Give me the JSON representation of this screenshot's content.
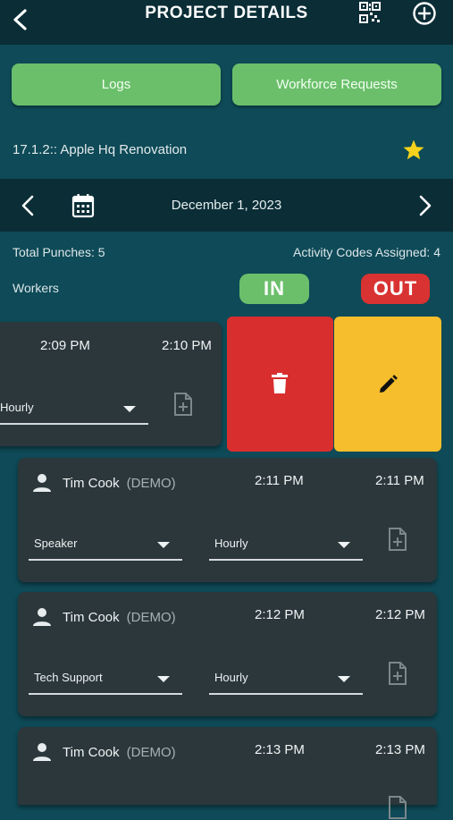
{
  "header": {
    "title": "PROJECT DETAILS"
  },
  "buttons": {
    "logs": "Logs",
    "workforce": "Workforce Requests"
  },
  "project": {
    "name": "17.1.2:: Apple Hq Renovation"
  },
  "datebar": {
    "date": "December 1, 2023"
  },
  "summary": {
    "total_punches": "Total Punches: 5",
    "activity_codes": "Activity Codes Assigned: 4",
    "workers_label": "Workers",
    "in_label": "IN",
    "out_label": "OUT"
  },
  "swiped_card": {
    "in_time": "2:09 PM",
    "out_time": "2:10 PM",
    "pay_type": "Hourly"
  },
  "cards": [
    {
      "first": "Tim",
      "last": "Cook",
      "tag": "(DEMO)",
      "in_time": "2:11 PM",
      "out_time": "2:11 PM",
      "activity": "Speaker",
      "pay_type": "Hourly"
    },
    {
      "first": "Tim",
      "last": "Cook",
      "tag": "(DEMO)",
      "in_time": "2:12 PM",
      "out_time": "2:12 PM",
      "activity": "Tech Support",
      "pay_type": "Hourly"
    },
    {
      "first": "Tim",
      "last": "Cook",
      "tag": "(DEMO)",
      "in_time": "2:13 PM",
      "out_time": "2:13 PM",
      "activity": "",
      "pay_type": ""
    }
  ],
  "colors": {
    "background": "#0e4a57",
    "header": "#0a2d36",
    "green": "#6bbf6b",
    "in_pill": "#6bbf6b",
    "out_pill": "#d93232",
    "delete": "#d92e2e",
    "edit": "#f6be2c",
    "star": "#f7d21c"
  },
  "icons": [
    "back-arrow-icon",
    "qr-code-icon",
    "add-circle-icon",
    "star-icon",
    "chevron-left-icon",
    "calendar-icon",
    "chevron-right-icon",
    "trash-icon",
    "pencil-icon",
    "person-icon",
    "add-document-icon"
  ]
}
